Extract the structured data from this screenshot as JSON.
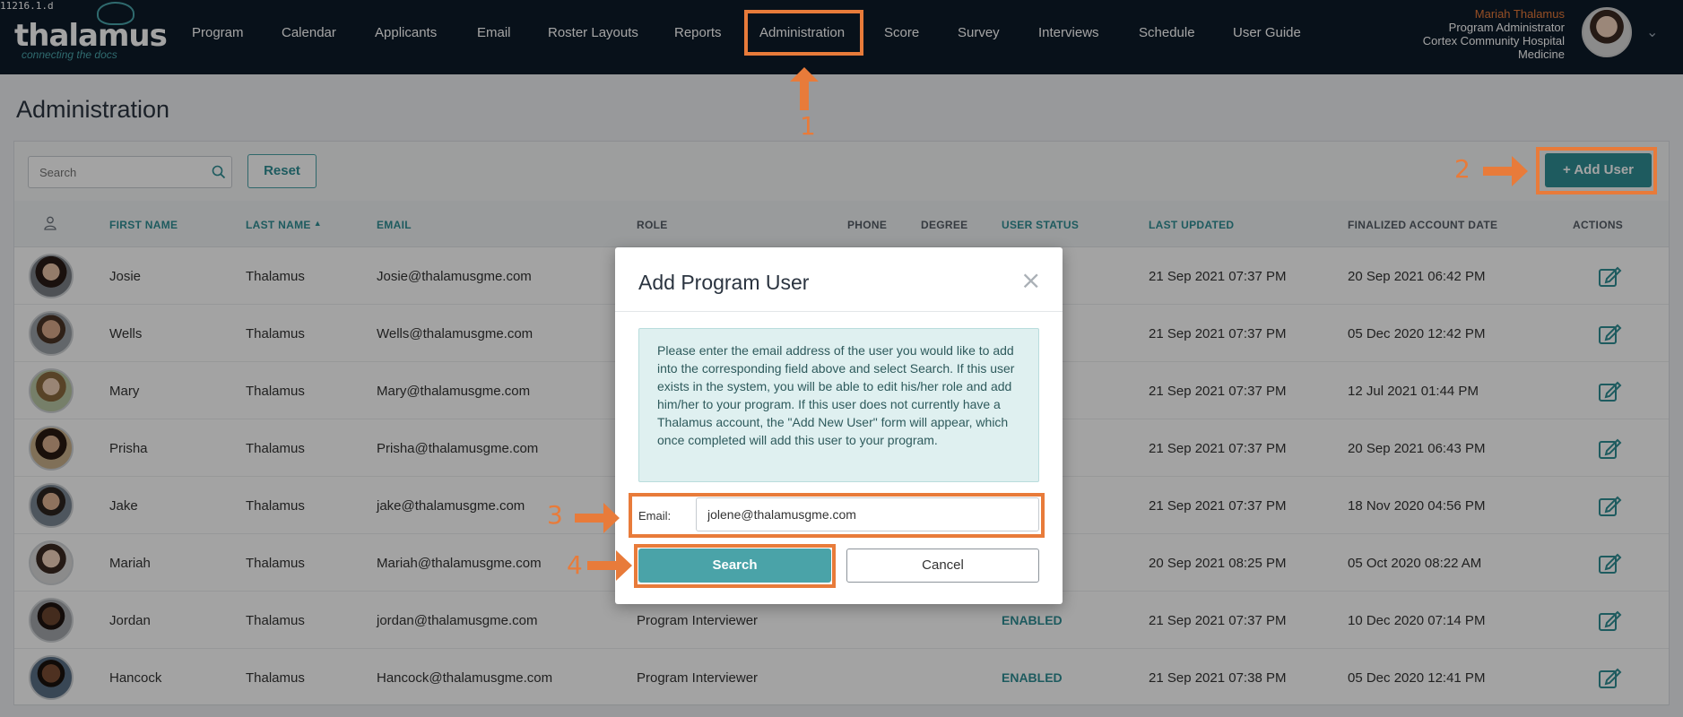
{
  "version_text": "11216.1.d",
  "brand": {
    "name": "thalamus",
    "tagline": "connecting the docs"
  },
  "nav": {
    "items": [
      "Program",
      "Calendar",
      "Applicants",
      "Email",
      "Roster Layouts",
      "Reports",
      "Administration",
      "Score",
      "Survey",
      "Interviews",
      "Schedule",
      "User Guide"
    ],
    "active": "Administration"
  },
  "user": {
    "name": "Mariah Thalamus",
    "role": "Program Administrator",
    "org": "Cortex Community Hospital",
    "dept": "Medicine"
  },
  "page": {
    "title": "Administration"
  },
  "toolbar": {
    "search_placeholder": "Search",
    "reset_label": "Reset",
    "add_user_label": "+ Add User"
  },
  "table": {
    "columns": [
      "FIRST NAME",
      "LAST NAME",
      "EMAIL",
      "ROLE",
      "PHONE",
      "DEGREE",
      "USER STATUS",
      "LAST UPDATED",
      "FINALIZED ACCOUNT DATE",
      "ACTIONS"
    ],
    "sorted_column": "LAST NAME",
    "rows": [
      {
        "first": "Josie",
        "last": "Thalamus",
        "email": "Josie@thalamusgme.com",
        "role": "",
        "status": "",
        "updated": "21 Sep 2021 07:37 PM",
        "finalized": "20 Sep 2021 06:42 PM"
      },
      {
        "first": "Wells",
        "last": "Thalamus",
        "email": "Wells@thalamusgme.com",
        "role": "",
        "status": "",
        "updated": "21 Sep 2021 07:37 PM",
        "finalized": "05 Dec 2020 12:42 PM"
      },
      {
        "first": "Mary",
        "last": "Thalamus",
        "email": "Mary@thalamusgme.com",
        "role": "",
        "status": "",
        "updated": "21 Sep 2021 07:37 PM",
        "finalized": "12 Jul 2021 01:44 PM"
      },
      {
        "first": "Prisha",
        "last": "Thalamus",
        "email": "Prisha@thalamusgme.com",
        "role": "",
        "status": "",
        "updated": "21 Sep 2021 07:37 PM",
        "finalized": "20 Sep 2021 06:43 PM"
      },
      {
        "first": "Jake",
        "last": "Thalamus",
        "email": "jake@thalamusgme.com",
        "role": "",
        "status": "",
        "updated": "21 Sep 2021 07:37 PM",
        "finalized": "18 Nov 2020 04:56 PM"
      },
      {
        "first": "Mariah",
        "last": "Thalamus",
        "email": "Mariah@thalamusgme.com",
        "role": "",
        "status": "",
        "updated": "20 Sep 2021 08:25 PM",
        "finalized": "05 Oct 2020 08:22 AM"
      },
      {
        "first": "Jordan",
        "last": "Thalamus",
        "email": "jordan@thalamusgme.com",
        "role": "Program Interviewer",
        "status": "ENABLED",
        "updated": "21 Sep 2021 07:37 PM",
        "finalized": "10 Dec 2020 07:14 PM"
      },
      {
        "first": "Hancock",
        "last": "Thalamus",
        "email": "Hancock@thalamusgme.com",
        "role": "Program Interviewer",
        "status": "ENABLED",
        "updated": "21 Sep 2021 07:38 PM",
        "finalized": "05 Dec 2020 12:41 PM"
      }
    ]
  },
  "modal": {
    "title": "Add Program User",
    "info": "Please enter the email address of the user you would like to add into the corresponding field above and select Search. If this user exists in the system, you will be able to edit his/her role and add him/her to your program. If this user does not currently have a Thalamus account, the \"Add New User\" form will appear, which once completed will add this user to your program.",
    "email_label": "Email:",
    "email_value": "jolene@thalamusgme.com",
    "search_label": "Search",
    "cancel_label": "Cancel"
  },
  "annotations": {
    "steps": [
      "1",
      "2",
      "3",
      "4"
    ],
    "color": "#e87b3a"
  },
  "colors": {
    "nav_bg": "#0e1b2a",
    "teal": "#2f8f95",
    "orange": "#e87b3a"
  }
}
